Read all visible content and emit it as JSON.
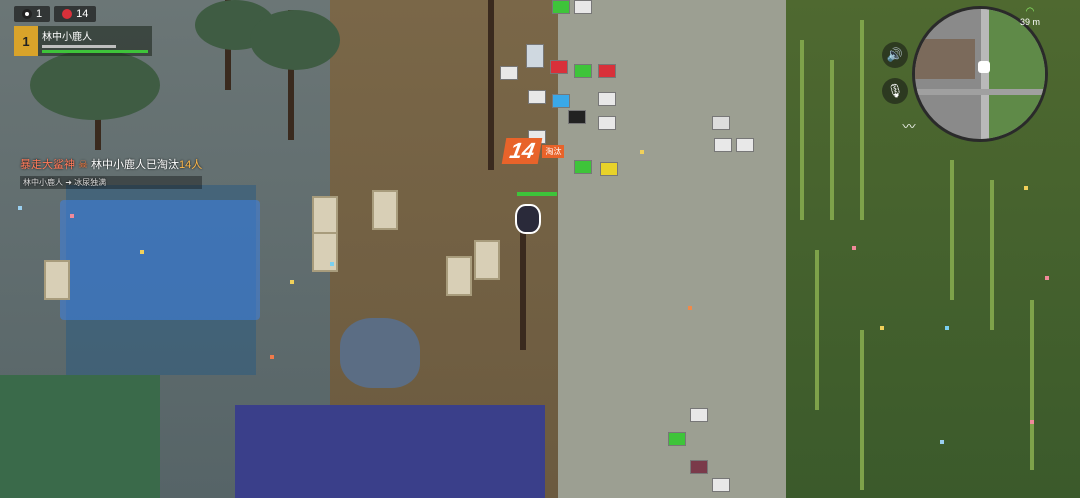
{
  "hud": {
    "alive_count": "1",
    "kill_count": "14",
    "team_icon": "panda-face-icon",
    "kill_icon": "skull-icon"
  },
  "player": {
    "rank": "1",
    "name": "林中小鹿人",
    "health_color": "#3ec43a"
  },
  "killfeed": {
    "killer": "暴走大鲨神",
    "victim": "林中小鹿人",
    "text_mid": "已淘汰",
    "count": "14人",
    "sub_left": "林中小鹿人",
    "sub_right": "冰尿独满"
  },
  "kill_badge": {
    "number": "14",
    "tag": "淘汰"
  },
  "minimap": {
    "distance": "39 m"
  },
  "colors": {
    "accent": "#e8632a",
    "health": "#3ec43a",
    "rank": "#d9a32a"
  }
}
